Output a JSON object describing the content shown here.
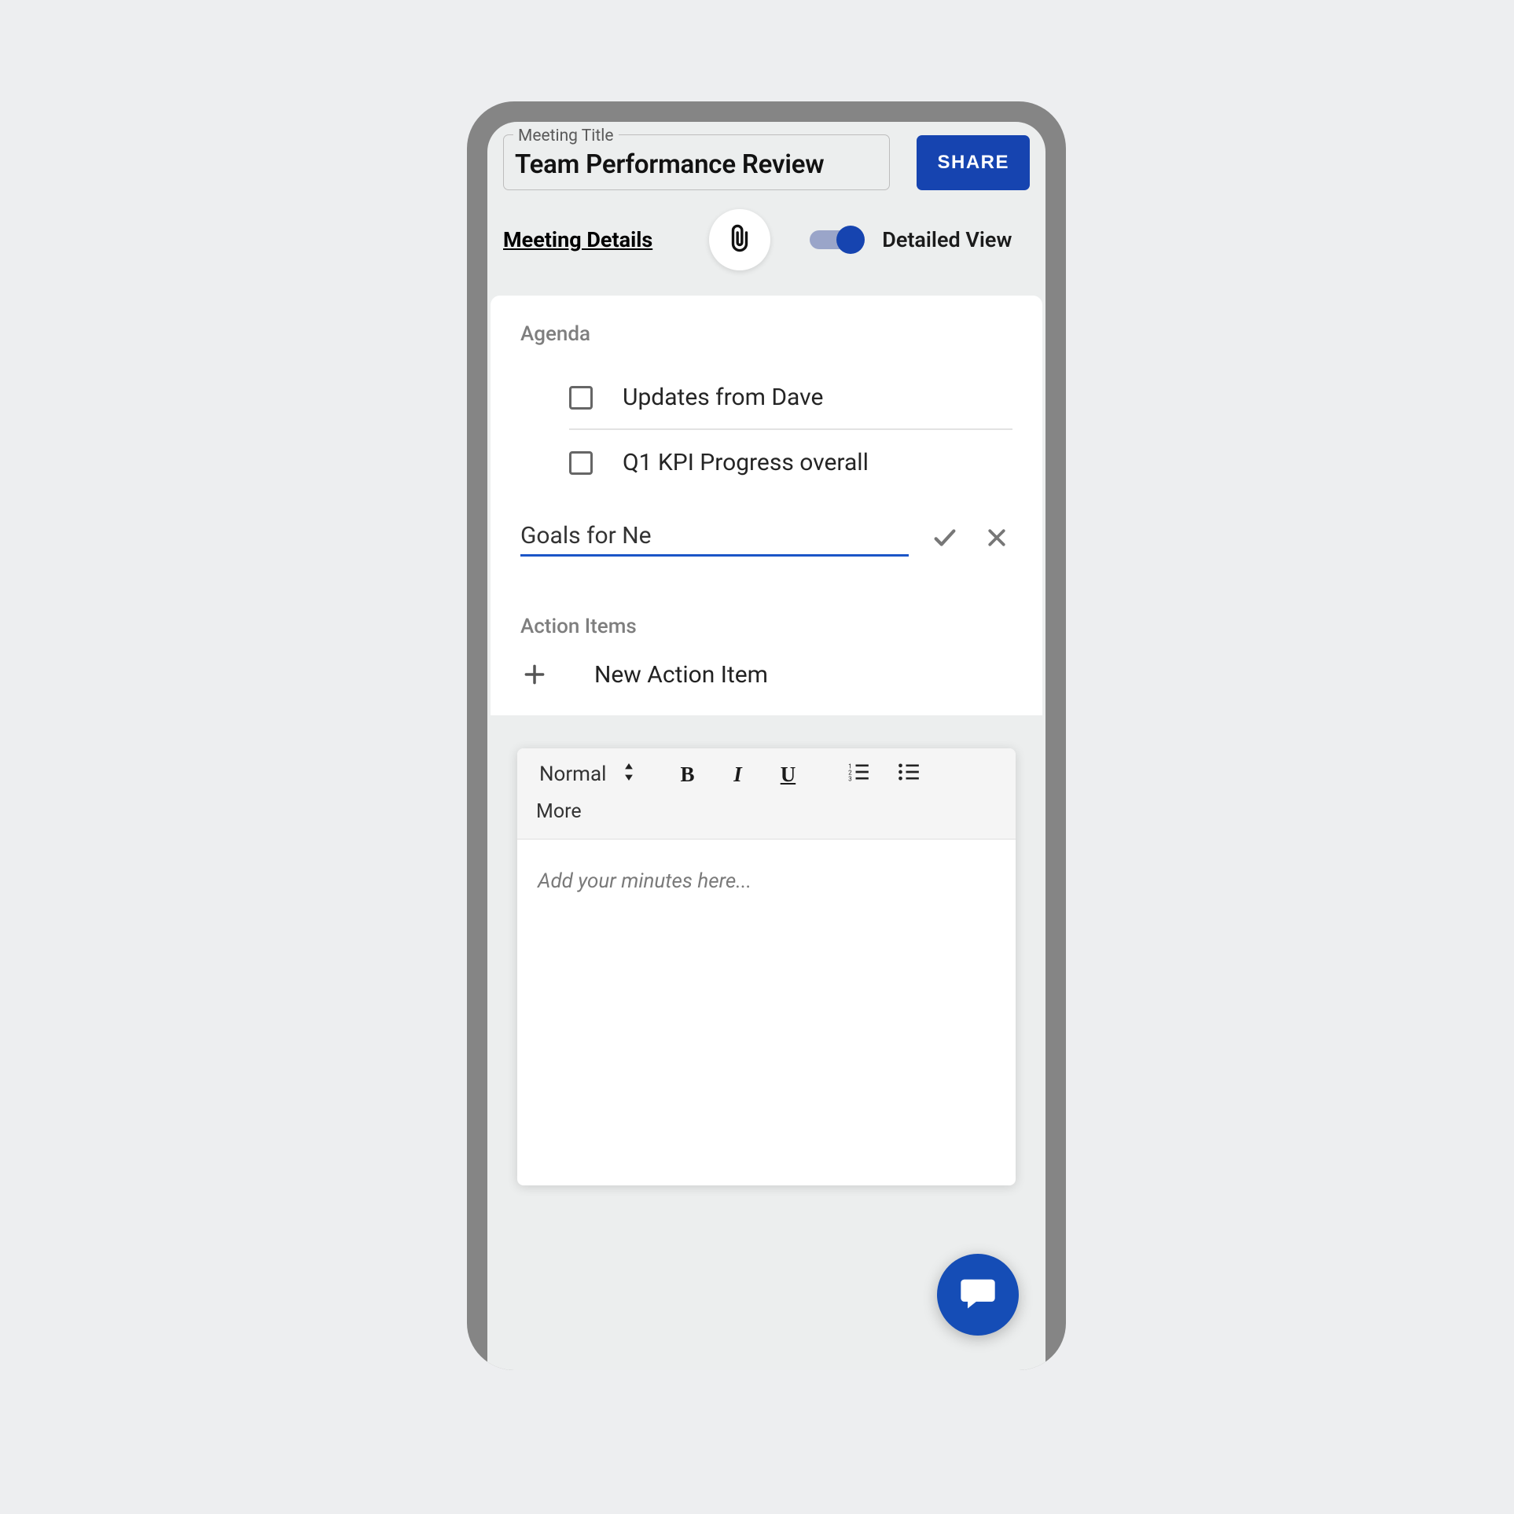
{
  "header": {
    "title_field_label": "Meeting Title",
    "title_value": "Team Performance Review",
    "share_label": "SHARE",
    "meeting_details_label": "Meeting Details",
    "detailed_view_label": "Detailed View",
    "detailed_view_on": true
  },
  "agenda": {
    "heading": "Agenda",
    "items": [
      {
        "label": "Updates from Dave",
        "checked": false
      },
      {
        "label": "Q1 KPI Progress overall",
        "checked": false
      }
    ],
    "new_item_input": "Goals for Ne"
  },
  "action_items": {
    "heading": "Action Items",
    "new_label": "New Action Item"
  },
  "editor": {
    "format_label": "Normal",
    "more_label": "More",
    "placeholder": "Add your minutes here..."
  },
  "icons": {
    "attachment": "attachment-icon",
    "checkmark": "checkmark-icon",
    "close": "close-icon",
    "plus": "plus-icon",
    "bold": "bold-icon",
    "italic": "italic-icon",
    "underline": "underline-icon",
    "ordered_list": "ordered-list-icon",
    "unordered_list": "unordered-list-icon",
    "updown": "select-updown-icon",
    "chat": "chat-icon"
  },
  "colors": {
    "accent": "#1644b0"
  }
}
